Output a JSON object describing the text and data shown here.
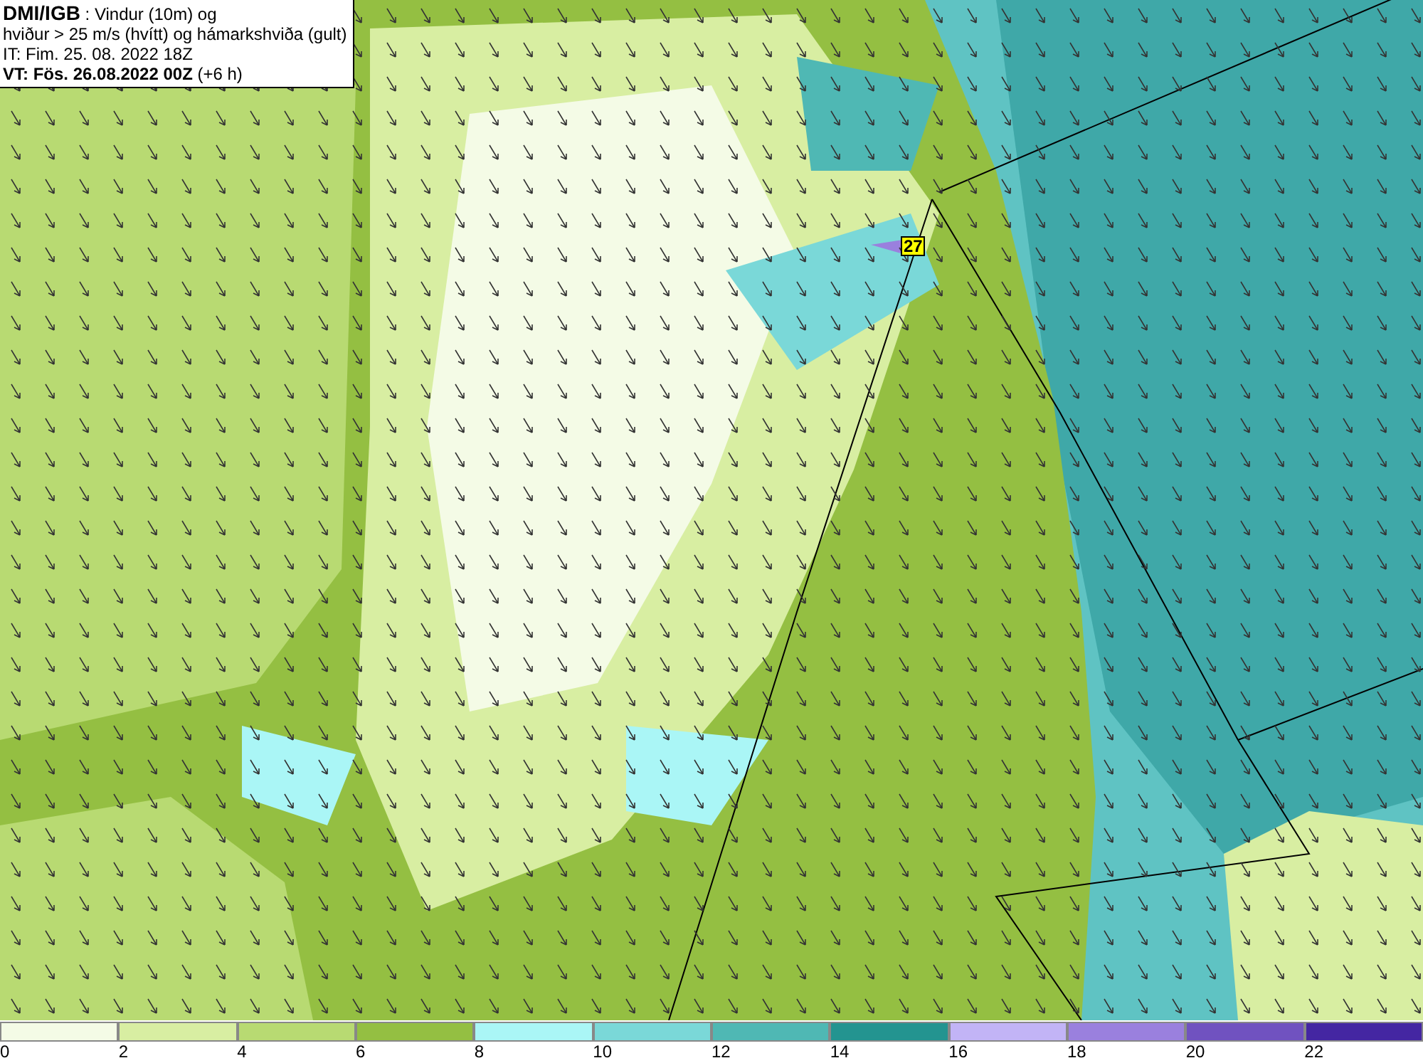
{
  "header": {
    "source": "DMI/IGB",
    "title_rest": " : Vindur (10m) og",
    "subtitle": "hviður > 25 m/s (hvítt) og hámarkshviða (gult)",
    "issue_time": "IT: Fim. 25. 08. 2022 18Z",
    "valid_time_bold": "VT: Fös. 26.08.2022 00Z",
    "valid_offset": " (+6 h)"
  },
  "map": {
    "gust_labels": [
      {
        "text": "27"
      }
    ]
  },
  "legend": {
    "items": [
      {
        "label": "0",
        "color": "#f4fbe6"
      },
      {
        "label": "2",
        "color": "#d8eea2"
      },
      {
        "label": "4",
        "color": "#b8da72"
      },
      {
        "label": "6",
        "color": "#94bf42"
      },
      {
        "label": "8",
        "color": "#aaf6f6"
      },
      {
        "label": "10",
        "color": "#7ad8d8"
      },
      {
        "label": "12",
        "color": "#4fb8b4"
      },
      {
        "label": "14",
        "color": "#239490"
      },
      {
        "label": "16",
        "color": "#c2b4f6"
      },
      {
        "label": "18",
        "color": "#9a80de"
      },
      {
        "label": "20",
        "color": "#7052c0"
      },
      {
        "label": "22",
        "color": "#4426a2"
      }
    ]
  }
}
